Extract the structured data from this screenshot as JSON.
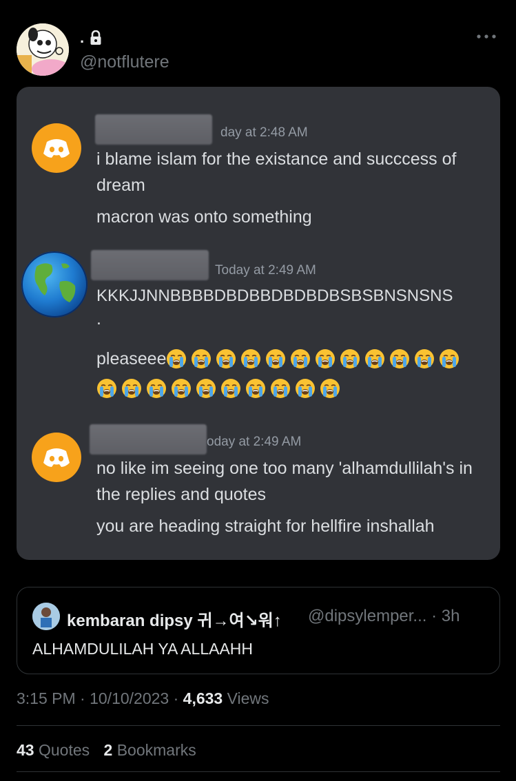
{
  "tweet": {
    "display_name": ".",
    "handle": "@notflutere",
    "timestamp": "3:15 PM · 10/10/2023 · ",
    "views_count": "4,633",
    "views_label": " Views",
    "quotes_count": "43",
    "quotes_label": " Quotes",
    "bookmarks_count": "2",
    "bookmarks_label": " Bookmarks"
  },
  "discord": {
    "messages": [
      {
        "timestamp": "day at 2:48 AM",
        "lines": [
          "i blame islam for the existance and succcess of dream",
          "macron was onto something"
        ]
      },
      {
        "timestamp": "Today at 2:49 AM",
        "lines": [
          "KKKJJNNBBBBDBDBBDBDBDBSBSBNSNSNS",
          ".",
          "pleaseee"
        ]
      },
      {
        "timestamp": "oday at 2:49 AM",
        "lines": [
          "no like im seeing one too many 'alhamdullilah's in the replies and quotes",
          "you are heading straight for hellfire inshallah"
        ]
      }
    ],
    "cry_emoji_row1_count": 12,
    "cry_emoji_row2_count": 10
  },
  "quoted": {
    "name": "kembaran dipsy 귀→여↘워↑",
    "handle": "@dipsylemper... · 3h",
    "text": "ALHAMDULILAH YA ALLAAHH"
  },
  "colors": {
    "discord_bg": "#313338",
    "discord_avatar": "#f7a21b",
    "muted": "#71767b"
  }
}
